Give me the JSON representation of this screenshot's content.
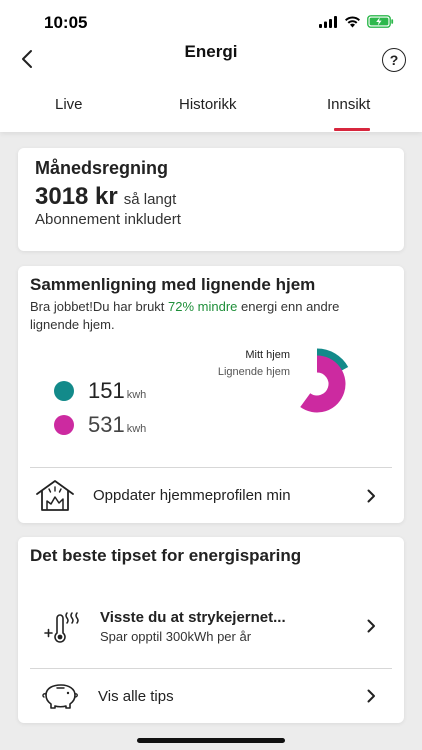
{
  "status_bar": {
    "time": "10:05"
  },
  "header": {
    "title": "Energi",
    "help_label": "?"
  },
  "tabs": [
    {
      "label": "Live"
    },
    {
      "label": "Historikk"
    },
    {
      "label": "Innsikt",
      "active": true
    }
  ],
  "bill_card": {
    "title": "Månedsregning",
    "amount": "3018 kr",
    "amount_suffix": "så langt",
    "subtitle": "Abonnement inkludert"
  },
  "comparison_card": {
    "title": "Sammenligning med lignende hjem",
    "desc_before": "Bra jobbet!Du har brukt ",
    "desc_highlight": "72% mindre",
    "desc_after": " energi enn andre lignende hjem.",
    "mine": {
      "value": "151",
      "unit": "kwh",
      "label": "Mitt hjem",
      "color": "#138a8a"
    },
    "similar": {
      "value": "531",
      "unit": "kwh",
      "label": "Lignende hjem",
      "color": "#cc2aa0"
    },
    "update_profile_label": "Oppdater hjemmeprofilen min"
  },
  "chart_data": {
    "type": "pie",
    "labels": [
      "Mitt hjem",
      "Lignende hjem"
    ],
    "values": [
      151,
      531
    ],
    "unit": "kwh",
    "colors": [
      "#138a8a",
      "#cc2aa0"
    ]
  },
  "tips_card": {
    "title": "Det beste tipset for energisparing",
    "tip_title": "Visste du at strykejernet...",
    "tip_subtitle": "Spar opptil 300kWh per år",
    "all_tips_label": "Vis alle tips"
  },
  "icons": {
    "back": "chevron-left-icon",
    "help": "help-icon",
    "house": "house-icon",
    "thermometer": "thermometer-heat-icon",
    "piggy": "piggy-bank-icon",
    "chevron": "chevron-right-icon"
  },
  "colors": {
    "accent": "#d7263d",
    "highlight_green": "#1f8f3a"
  }
}
